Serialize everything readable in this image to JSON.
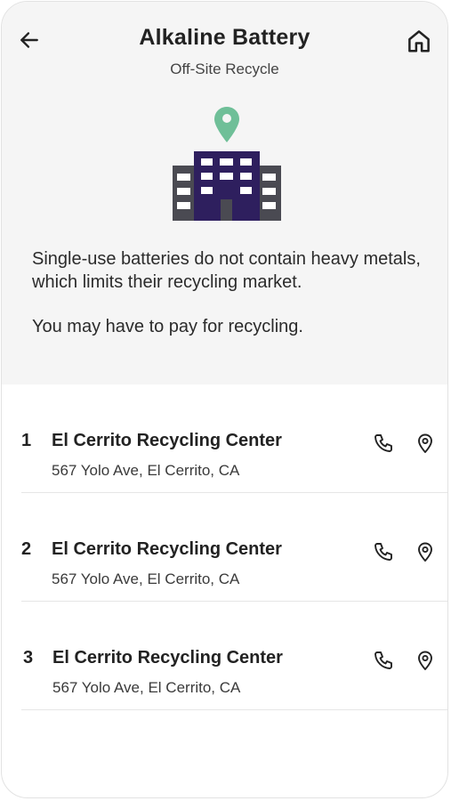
{
  "header": {
    "title": "Alkaline Battery",
    "subtitle": "Off-Site Recycle",
    "back_icon": "arrow-left-icon",
    "home_icon": "home-icon"
  },
  "illustration": {
    "icon": "building-with-location-pin",
    "pin_color": "#6fbf98",
    "building_color": "#2e1f5e",
    "wing_color": "#4a4a52"
  },
  "description": {
    "paragraph_1": "Single-use batteries do not contain heavy metals, which limits their recycling market.",
    "paragraph_2": "You may have to pay for recycling."
  },
  "locations": [
    {
      "number": "1",
      "name": "El Cerrito Recycling Center",
      "address": "567 Yolo Ave, El Cerrito, CA"
    },
    {
      "number": "2",
      "name": "El Cerrito Recycling Center",
      "address": "567 Yolo Ave, El Cerrito, CA"
    },
    {
      "number": "3",
      "name": "El Cerrito Recycling Center",
      "address": "567 Yolo Ave, El Cerrito, CA"
    }
  ],
  "colors": {
    "panel_background": "#f5f5f5",
    "text_primary": "#222222"
  }
}
